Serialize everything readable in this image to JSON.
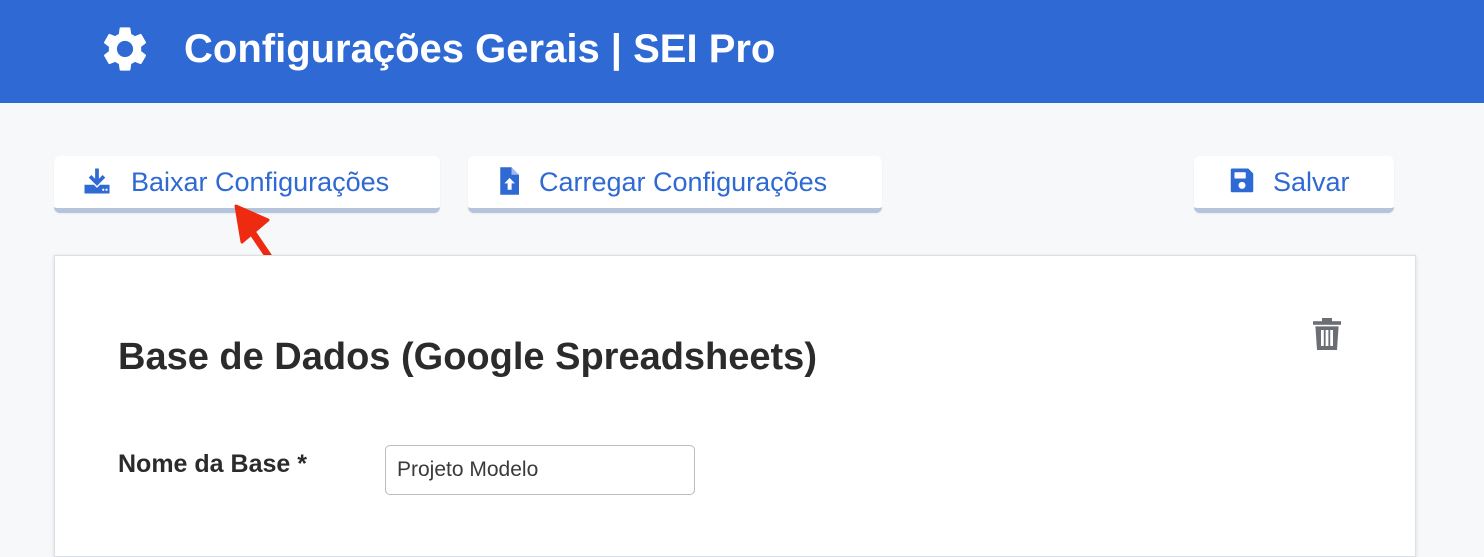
{
  "header": {
    "title": "Configurações Gerais | SEI Pro",
    "icon": "gear-icon",
    "background_color": "#2e69d4"
  },
  "toolbar": {
    "download_label": "Baixar Configurações",
    "download_icon": "download-icon",
    "upload_label": "Carregar Configurações",
    "upload_icon": "file-upload-icon",
    "save_label": "Salvar",
    "save_icon": "floppy-disk-icon",
    "accent_color": "#2e69d4"
  },
  "annotation": {
    "icon": "red-arrow-icon",
    "color": "#ee2a10"
  },
  "card": {
    "title": "Base de Dados (Google Spreadsheets)",
    "delete_icon": "trash-icon",
    "fields": [
      {
        "label": "Nome da Base *",
        "value": "Projeto Modelo"
      }
    ]
  }
}
